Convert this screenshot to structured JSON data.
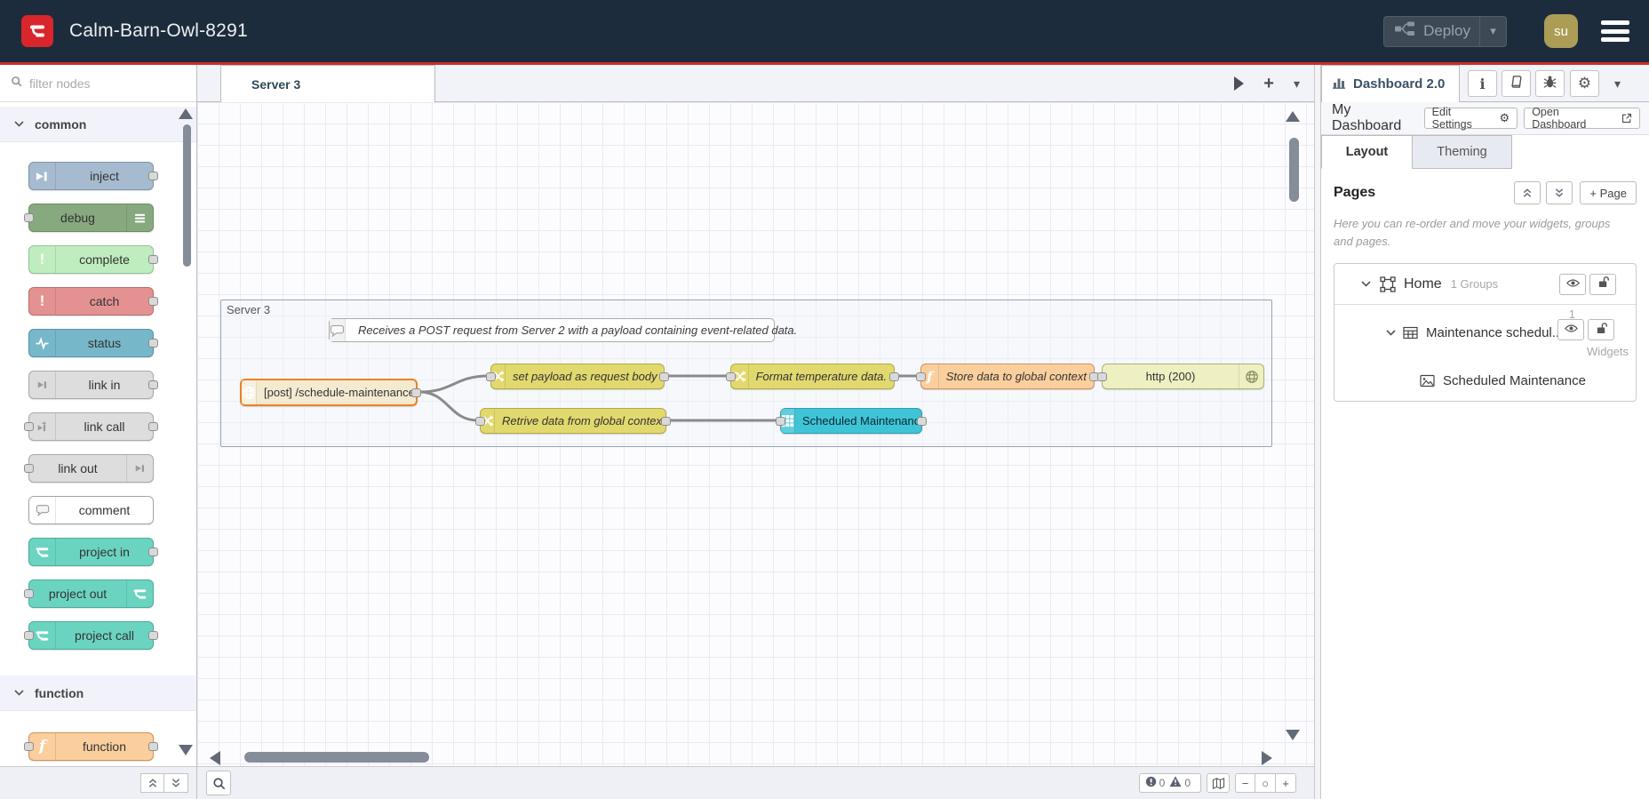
{
  "header": {
    "title": "Calm-Barn-Owl-8291",
    "deploy_label": "Deploy",
    "avatar_initials": "su"
  },
  "icons": {
    "caret_down": "▾",
    "gear": "⚙",
    "info": "i",
    "exclamation": "!",
    "function_f": "f",
    "plus": "+",
    "minus": "−",
    "zoom_reset": "○"
  },
  "palette": {
    "search_placeholder": "filter nodes",
    "categories": [
      {
        "label": "common",
        "items": [
          {
            "label": "inject"
          },
          {
            "label": "debug"
          },
          {
            "label": "complete"
          },
          {
            "label": "catch"
          },
          {
            "label": "status"
          },
          {
            "label": "link in"
          },
          {
            "label": "link call"
          },
          {
            "label": "link out"
          },
          {
            "label": "comment"
          },
          {
            "label": "project in"
          },
          {
            "label": "project out"
          },
          {
            "label": "project call"
          }
        ]
      },
      {
        "label": "function",
        "items": [
          {
            "label": "function"
          }
        ]
      }
    ]
  },
  "workspace": {
    "tab": "Server 3"
  },
  "flow": {
    "group_label": "Server 3",
    "comment": "Receives a POST request from Server 2 with a payload containing event-related data.",
    "nodes": {
      "http_in": "[post] /schedule-maintenance",
      "set_payload": "set payload as request body",
      "format_temp": "Format temperature data.",
      "store_global": "Store data to global context",
      "http_response": "http (200)",
      "retrieve_global": "Retrive data from global context",
      "table_widget": "Scheduled Maintenance"
    }
  },
  "statusbar": {
    "errors": "0",
    "warnings": "0"
  },
  "sidebar": {
    "tab_label": "Dashboard 2.0",
    "dashboard_name": "My Dashboard",
    "edit_settings_label": "Edit Settings",
    "open_dashboard_label": "Open Dashboard",
    "tabs": {
      "layout": "Layout",
      "theming": "Theming"
    },
    "pages_title": "Pages",
    "add_page_label": "+ Page",
    "hint": "Here you can re-order and move your widgets, groups and pages.",
    "tree": {
      "page": {
        "label": "Home",
        "meta": "1 Groups"
      },
      "group": {
        "label": "Maintenance schedul...",
        "meta_count": "1",
        "meta_word": "Widgets"
      },
      "widget": {
        "label": "Scheduled Maintenance"
      }
    }
  },
  "colors": {
    "header_bg": "#1d2c3c",
    "accent_red": "#c7302b",
    "logo_red": "#d9252c",
    "node_inject": "#a6bbcf",
    "node_debug": "#87a980",
    "node_complete": "#c0edc0",
    "node_catch": "#e49191",
    "node_status": "#76b7c9",
    "node_link": "#dddddd",
    "node_project": "#6bd4c0",
    "node_function": "#fbcf9d",
    "node_change": "#e2d96e",
    "node_http_in": "#f4ead0",
    "node_http_response": "#eef0c2",
    "node_ui_widget": "#3fc4d7",
    "selected_border": "#ed8223"
  }
}
